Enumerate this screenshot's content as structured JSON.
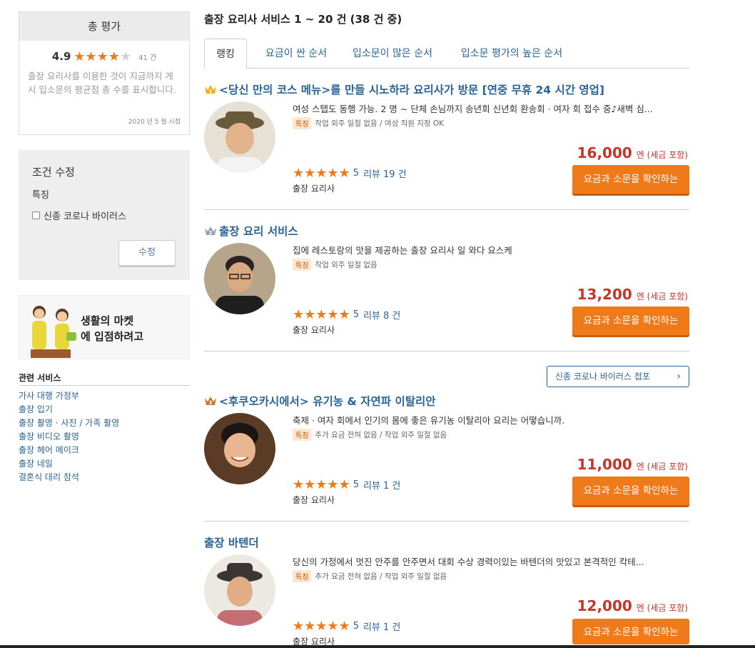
{
  "summary": {
    "title": "총 평가",
    "score": "4.9",
    "stars": "★★★★",
    "stars_off": "★",
    "count": "41 건",
    "description": "출장 요리사를 이용한 것이 지금까지 게시 입소문의 평균점 총 수를 표시합니다.",
    "date": "2020 년 5 월 시점"
  },
  "filter": {
    "title": "조건 수정",
    "subtitle": "특징",
    "checkbox_label": "신종 코로나 바이러스",
    "button_label": "수정"
  },
  "banner": {
    "line1": "생활의 마켓",
    "line2": "에 입점하려고"
  },
  "related": {
    "title": "관련 서비스",
    "items": [
      "가사 대행 가정부",
      "출장 입기",
      "출장 촬영 · 사진 / 가족 촬영",
      "출장 비디오 촬영",
      "출장 헤어 메이크",
      "출장 네일",
      "결혼식 대리 참석"
    ]
  },
  "main": {
    "result_title": "출장 요리사 서비스 1 ~ 20 건 (38 건 중)",
    "tabs": [
      "랭킹",
      "요금이 싼 순서",
      "입소문이 많은 순서",
      "입소문 평가의 높은 순서"
    ],
    "corona_link": "신종 코로나 바이러스 접포",
    "listings": [
      {
        "title": "<당신 만의 코스 메뉴>를 만들 시노하라 요리사가 방문 [연중 무휴 24 시간 영업]",
        "description": "여성 스탭도 동행 가능. 2 명 ~ 단체 손님까지 송년회 신년회 환송회 · 여자 회 접수 중♪새벽 심...",
        "feature_tag": "특징",
        "features": "작업 외주 일절 없음 / 여성 직원 지정 OK",
        "stars": "★★★★★",
        "score": "5",
        "review_label": "리뷰 19 건",
        "category": "출장 요리사",
        "price": "16,000",
        "price_unit": "엔 (세금 포함)",
        "cta": "요금과 소문을 확인하는"
      },
      {
        "title": "출장 요리 서비스",
        "description": "집에 레스토랑의 맛을 제공하는 출장 요리사 일 와다 요스케",
        "feature_tag": "특징",
        "features": "작업 외주 일절 없음",
        "stars": "★★★★★",
        "score": "5",
        "review_label": "리뷰 8 건",
        "category": "출장 요리사",
        "price": "13,200",
        "price_unit": "엔 (세금 포함)",
        "cta": "요금과 소문을 확인하는"
      },
      {
        "title": "<후쿠오카시에서> 유기농 & 자연파 이탈리안",
        "description": "축제 · 여자 회에서 인기의 몸에 좋은 유기농 이탈리아 요리는 어떻습니까.",
        "feature_tag": "특징",
        "features": "추가 요금 전혀 없음 / 작업 외주 일절 없음",
        "stars": "★★★★★",
        "score": "5",
        "review_label": "리뷰 1 건",
        "category": "출장 요리사",
        "price": "11,000",
        "price_unit": "엔 (세금 포함)",
        "cta": "요금과 소문을 확인하는"
      },
      {
        "title": "출장 바텐더",
        "description": "당신의 가정에서 멋진 안주를 안주면서 대회 수상 경력이있는 바텐더의 맛있고 본격적인 칵테...",
        "feature_tag": "특징",
        "features": "추가 요금 전혀 없음 / 작업 외주 일절 없음",
        "stars": "★★★★★",
        "score": "5",
        "review_label": "리뷰 1 건",
        "category": "출장 요리사",
        "price": "12,000",
        "price_unit": "엔 (세금 포함)",
        "cta": "요금과 소문을 확인하는"
      }
    ]
  },
  "colors": {
    "accent": "#ef7a1a",
    "link": "#2a6496",
    "price": "#c7352a"
  }
}
